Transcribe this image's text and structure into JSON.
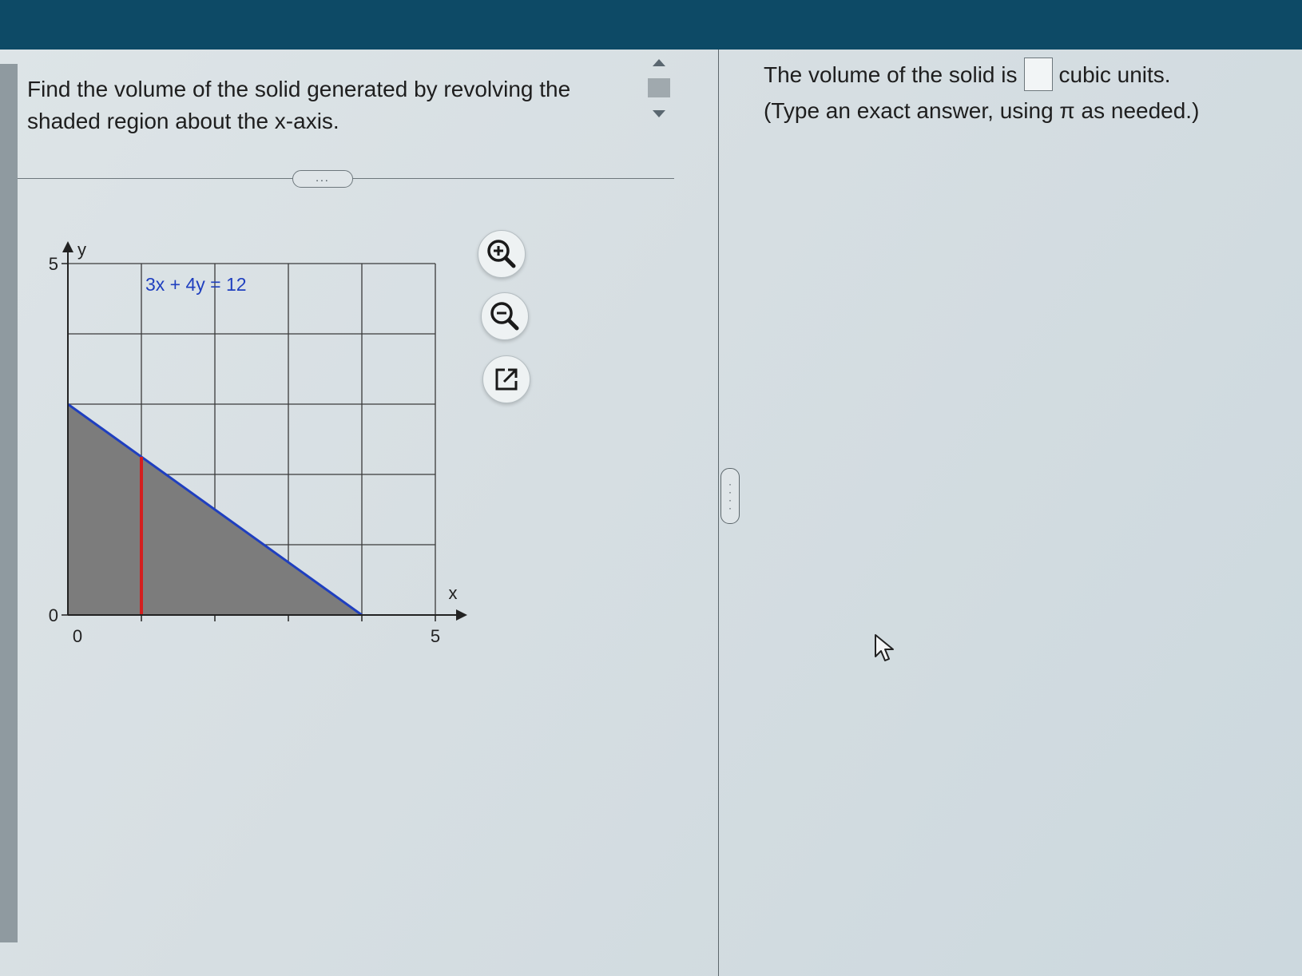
{
  "question": {
    "text": "Find the volume of the solid generated by revolving the shaded region about the x-axis."
  },
  "answer": {
    "prefix": "The volume of the solid is",
    "suffix": "cubic units.",
    "hint": "(Type an exact answer, using π as needed.)",
    "value": ""
  },
  "tools": {
    "zoom_in_icon": "zoom-in-icon",
    "zoom_out_icon": "zoom-out-icon",
    "popout_icon": "external-link-icon"
  },
  "divider_grip": "...",
  "chart_data": {
    "type": "area",
    "equation_label": "3x + 4y = 12",
    "xlabel": "x",
    "ylabel": "y",
    "xlim": [
      0,
      5
    ],
    "ylim": [
      0,
      5
    ],
    "x_tick_labels": [
      "0",
      "5"
    ],
    "y_tick_labels": [
      "0",
      "5"
    ],
    "grid": true,
    "line": {
      "x": [
        0,
        4
      ],
      "y": [
        3,
        0
      ],
      "color": "#1f3fbf"
    },
    "shaded_region": {
      "x": [
        0,
        0,
        4
      ],
      "y": [
        0,
        3,
        0
      ],
      "color": "#7c7c7c"
    },
    "slice_marker": {
      "x": 1,
      "color": "#d41e1e"
    }
  }
}
